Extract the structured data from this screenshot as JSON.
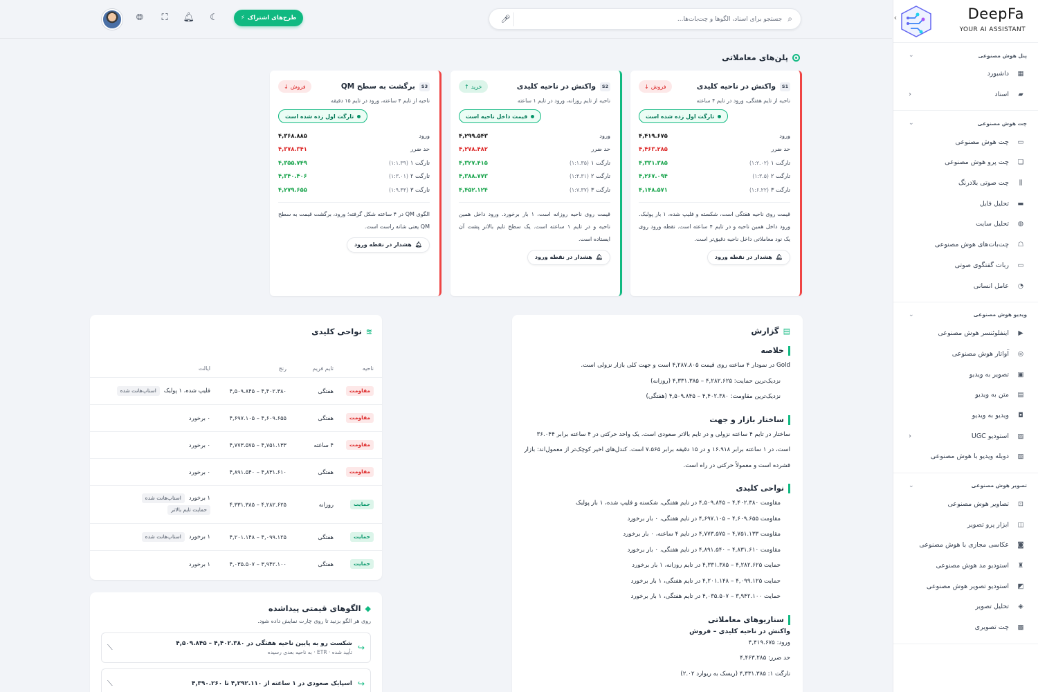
{
  "brand": {
    "name": "DeepFa",
    "tagline": "YOUR AI ASSISTANT"
  },
  "sidebar": {
    "groups": [
      {
        "title": "پنل هوش مصنوعی",
        "items": [
          {
            "label": "داشبورد",
            "icon": "grid-icon"
          },
          {
            "label": "اسناد",
            "icon": "folder-icon",
            "arrow": "‹"
          }
        ]
      },
      {
        "title": "چت هوش مصنوعی",
        "items": [
          {
            "label": "چت هوش مصنوعی",
            "icon": "chat-icon"
          },
          {
            "label": "چت پرو هوش مصنوعی",
            "icon": "chats-icon"
          },
          {
            "label": "چت صوتی بلادرنگ",
            "icon": "waveform-icon"
          },
          {
            "label": "تحلیل فایل",
            "icon": "file-icon"
          },
          {
            "label": "تحلیل سایت",
            "icon": "globe-icon"
          },
          {
            "label": "چت‌بات‌های هوش مصنوعی",
            "icon": "robot-icon"
          },
          {
            "label": "ربات گفتگوی صوتی",
            "icon": "voice-bot-icon"
          },
          {
            "label": "عامل انسانی",
            "icon": "headset-icon"
          }
        ]
      },
      {
        "title": "ویدیو هوش مصنوعی",
        "items": [
          {
            "label": "اینفلوئنسر هوش مصنوعی",
            "icon": "video-camera-icon"
          },
          {
            "label": "آواتار هوش مصنوعی",
            "icon": "avatar-icon"
          },
          {
            "label": "تصویر به ویدیو",
            "icon": "image-video-icon"
          },
          {
            "label": "متن به ویدیو",
            "icon": "text-video-icon"
          },
          {
            "label": "ویدیو به ویدیو",
            "icon": "video-video-icon"
          },
          {
            "label": "استودیو UGC",
            "icon": "studio-icon",
            "arrow": "‹"
          },
          {
            "label": "دوبله ویدیو با هوش مصنوعی",
            "icon": "dub-icon"
          }
        ]
      },
      {
        "title": "تصویر هوش مصنوعی",
        "items": [
          {
            "label": "تصاویر هوش مصنوعی",
            "icon": "image-scan-icon"
          },
          {
            "label": "ابزار پرو تصویر",
            "icon": "image-tool-icon"
          },
          {
            "label": "عکاسی مجازی با هوش مصنوعی",
            "icon": "camera-icon"
          },
          {
            "label": "استودیو مد هوش مصنوعی",
            "icon": "shirt-icon"
          },
          {
            "label": "استودیو تصویر هوش مصنوعی",
            "icon": "gallery-icon"
          },
          {
            "label": "تحلیل تصویر",
            "icon": "image-analyze-icon"
          },
          {
            "label": "چت تصویری",
            "icon": "image-chat-icon"
          }
        ]
      }
    ]
  },
  "topbar": {
    "search_placeholder": "جستجو برای اسناد، الگوها و چت‌بات‌ها...",
    "subscribe_label": "طرح‌های اشتراک"
  },
  "plans": {
    "title": "پلن‌های معاملاتی",
    "cards": [
      {
        "tag": "S1",
        "title": "واکنش در ناحیه کلیدی",
        "side": "فروش",
        "side_type": "sell",
        "subtitle": "ناحیه از تایم هفتگی، ورود در تایم ۴ ساعته",
        "status": "تارگت اول زده شده است",
        "entry_label": "ورود",
        "entry": "۴,۴۱۹.۶۷۵",
        "stop_label": "حد ضرر",
        "stop": "۴,۴۶۳.۲۸۵",
        "t1_label": "تارگت ۱",
        "t1_r": "(۱:۲.۰۲)",
        "t1": "۴,۳۳۱.۳۸۵",
        "t2_label": "تارگت ۲",
        "t2_r": "(۱:۳.۵)",
        "t2": "۴,۲۶۷.۰۹۴",
        "t3_label": "تارگت ۳",
        "t3_r": "(۱:۶.۲۲)",
        "t3": "۴,۱۴۸.۵۷۱",
        "desc": "قیمت روی ناحیه هفتگی است، شکسته و فلیپ شده، ۱ بار پولبک. ورود داخل همین ناحیه و در تایم ۴ ساعته است. نقطه ورود روی یک نود معاملاتی داخل ناحیه دقیق‌تر است.",
        "alert": "هشدار در نقطه ورود"
      },
      {
        "tag": "S2",
        "title": "واکنش در ناحیه کلیدی",
        "side": "خرید",
        "side_type": "buy",
        "subtitle": "ناحیه از تایم روزانه، ورود در تایم ۱ ساعته",
        "status": "قیمت داخل ناحیه است",
        "entry_label": "ورود",
        "entry": "۴,۲۹۹.۵۴۳",
        "stop_label": "حد ضرر",
        "stop": "۴,۲۷۸.۴۸۲",
        "t1_label": "تارگت ۱",
        "t1_r": "(۱:۱.۳۵)",
        "t1": "۴,۳۲۷.۴۱۵",
        "t2_label": "تارگت ۲",
        "t2_r": "(۱:۴.۳۱)",
        "t2": "۴,۳۸۸.۷۷۳",
        "t3_label": "تارگت ۳",
        "t3_r": "(۱:۷.۳۷)",
        "t3": "۴,۴۵۲.۱۲۴",
        "desc": "قیمت روی ناحیه روزانه است، ۱ بار برخورد. ورود داخل همین ناحیه و در تایم ۱ ساعته است. یک سطح تایم بالاتر پشت آن ایستاده است.",
        "alert": "هشدار در نقطه ورود"
      },
      {
        "tag": "S3",
        "title": "برگشت به سطح QM",
        "side": "فروش",
        "side_type": "sell",
        "subtitle": "ناحیه از تایم ۴ ساعته، ورود در تایم ۱۵ دقیقه",
        "status": "تارگت اول زده شده است",
        "entry_label": "ورود",
        "entry": "۴,۳۶۸.۸۸۵",
        "stop_label": "حد ضرر",
        "stop": "۴,۳۷۸.۳۴۱",
        "t1_label": "تارگت ۱",
        "t1_r": "(۱:۱.۳۹)",
        "t1": "۴,۳۵۵.۷۴۹",
        "t2_label": "تارگت ۲",
        "t2_r": "(۱:۳.۰۱)",
        "t2": "۴,۳۴۰.۴۰۶",
        "t3_label": "تارگت ۳",
        "t3_r": "(۱:۹.۴۴)",
        "t3": "۴,۲۷۹.۶۵۵",
        "desc": "الگوی QM در ۴ ساعته شکل گرفته؛ ورود، برگشت قیمت به سطح QM یعنی شانه راست است.",
        "alert": "هشدار در نقطه ورود"
      }
    ]
  },
  "report": {
    "title": "گزارش",
    "summary_h": "خلاصه",
    "summary_p": "Gold در نمودار ۴ ساعته روی قیمت ۴,۲۸۷.۸۰۵ است و جهت کلی بازار نزولی است.",
    "support_line": "نزدیک‌ترین حمایت: ۴,۲۸۲.۶۲۵ – ۴,۳۳۱.۳۸۵ (روزانه)",
    "resistance_line": "نزدیک‌ترین مقاومت: ۴,۴۰۲.۳۸۰ – ۴,۵۰۹.۸۴۵ (هفتگی)",
    "structure_h": "ساختار بازار و جهت",
    "structure_p": "ساختار در تایم ۴ ساعته نزولی و در تایم بالاتر صعودی است. یک واحد حرکتی در ۴ ساعته برابر ۳۶.۰۴۴ است، در ۱ ساعته برابر ۱۶.۹۱۸ و در ۱۵ دقیقه برابر ۷.۵۶۵ است. کندل‌های اخیر کوچک‌تر از معمول‌اند: بازار فشرده است و معمولاً حرکتی در راه است.",
    "zones_h": "نواحی کلیدی",
    "zones": [
      "مقاومت ۴,۴۰۲.۳۸۰ – ۴,۵۰۹.۸۴۵ در تایم هفتگی، شکسته و فلیپ شده، ۱ بار پولبک",
      "مقاومت ۴,۶۰۹.۶۵۵ – ۴,۶۹۷.۱۰۵ در تایم هفتگی، ۰ بار برخورد",
      "مقاومت ۴,۷۵۱.۱۳۳ – ۴,۷۷۳.۵۷۵ در تایم ۴ ساعته، ۰ بار برخورد",
      "مقاومت ۴,۸۳۱.۶۱۰ – ۴,۸۹۱.۵۴۰ در تایم هفتگی، ۰ بار برخورد",
      "حمایت ۴,۲۸۲.۶۲۵ – ۴,۳۳۱.۳۸۵ در تایم روزانه، ۱ بار برخورد",
      "حمایت ۴,۰۹۹.۱۲۵ – ۴,۲۰۱.۱۴۸ در تایم هفتگی، ۱ بار برخورد",
      "حمایت ۳,۹۴۲.۱۰۰ – ۴,۰۳۵.۵۰۷ در تایم هفتگی، ۱ بار برخورد"
    ],
    "scenarios_h": "سناریوهای معاملاتی",
    "scenario_title": "واکنش در ناحیه کلیدی – فروش",
    "scenario_entry": "ورود: ۴,۴۱۹.۶۷۵",
    "scenario_stop": "حد ضرر: ۴,۴۶۳.۲۸۵",
    "scenario_t1": "تارگت ۱: ۴,۳۳۱.۳۸۵ (ریسک به ریوارد ۲.۰۲)"
  },
  "zones_card": {
    "title": "نواحی کلیدی",
    "headers": [
      "ناحیه",
      "تایم فریم",
      "رنج",
      "ایالت"
    ],
    "rows": [
      {
        "type": "مقاومت",
        "kind": "res",
        "tf": "هفتگی",
        "range": "۴,۴۰۲.۳۸۰ – ۴,۵۰۹.۸۴۵",
        "state": "فلیپ شده، ۱ پولبک",
        "badge": "استاپ‌هانت شده",
        "badge2": ""
      },
      {
        "type": "مقاومت",
        "kind": "res",
        "tf": "هفتگی",
        "range": "۴,۶۰۹.۶۵۵ – ۴,۶۹۷.۱۰۵",
        "state": "۰ برخورد",
        "badge": "",
        "badge2": ""
      },
      {
        "type": "مقاومت",
        "kind": "res",
        "tf": "۴ ساعته",
        "range": "۴,۷۵۱.۱۳۳ – ۴,۷۷۳.۵۷۵",
        "state": "۰ برخورد",
        "badge": "",
        "badge2": ""
      },
      {
        "type": "مقاومت",
        "kind": "res",
        "tf": "هفتگی",
        "range": "۴,۸۳۱.۶۱۰ – ۴,۸۹۱.۵۴۰",
        "state": "۰ برخورد",
        "badge": "",
        "badge2": ""
      },
      {
        "type": "حمایت",
        "kind": "sup",
        "tf": "روزانه",
        "range": "۴,۲۸۲.۶۲۵ – ۴,۳۳۱.۳۸۵",
        "state": "۱ برخورد",
        "badge": "استاپ‌هانت شده",
        "badge2": "حمایت تایم بالاتر"
      },
      {
        "type": "حمایت",
        "kind": "sup",
        "tf": "هفتگی",
        "range": "۴,۰۹۹.۱۲۵ – ۴,۲۰۱.۱۴۸",
        "state": "۱ برخورد",
        "badge": "استاپ‌هانت شده",
        "badge2": ""
      },
      {
        "type": "حمایت",
        "kind": "sup",
        "tf": "هفتگی",
        "range": "۳,۹۴۲.۱۰۰ – ۴,۰۳۵.۵۰۷",
        "state": "۱ برخورد",
        "badge": "",
        "badge2": ""
      }
    ]
  },
  "patterns": {
    "title": "الگوهای قیمتی پیداشده",
    "subtitle": "روی هر الگو بزنید تا روی چارت نمایش داده شود.",
    "items": [
      {
        "title": "شکست رو به پایین ناحیه هفتگی در ۴,۴۰۲.۳۸۰ – ۴,۵۰۹.۸۴۵",
        "sub": "تأیید شده · ETR · به ناحیه بعدی رسیده"
      },
      {
        "title": "اسپایک صعودی در ۱ ساعته از ۴,۲۹۲.۱۱۰ تا ۴,۳۹۰.۲۶۰",
        "sub": ""
      }
    ]
  }
}
